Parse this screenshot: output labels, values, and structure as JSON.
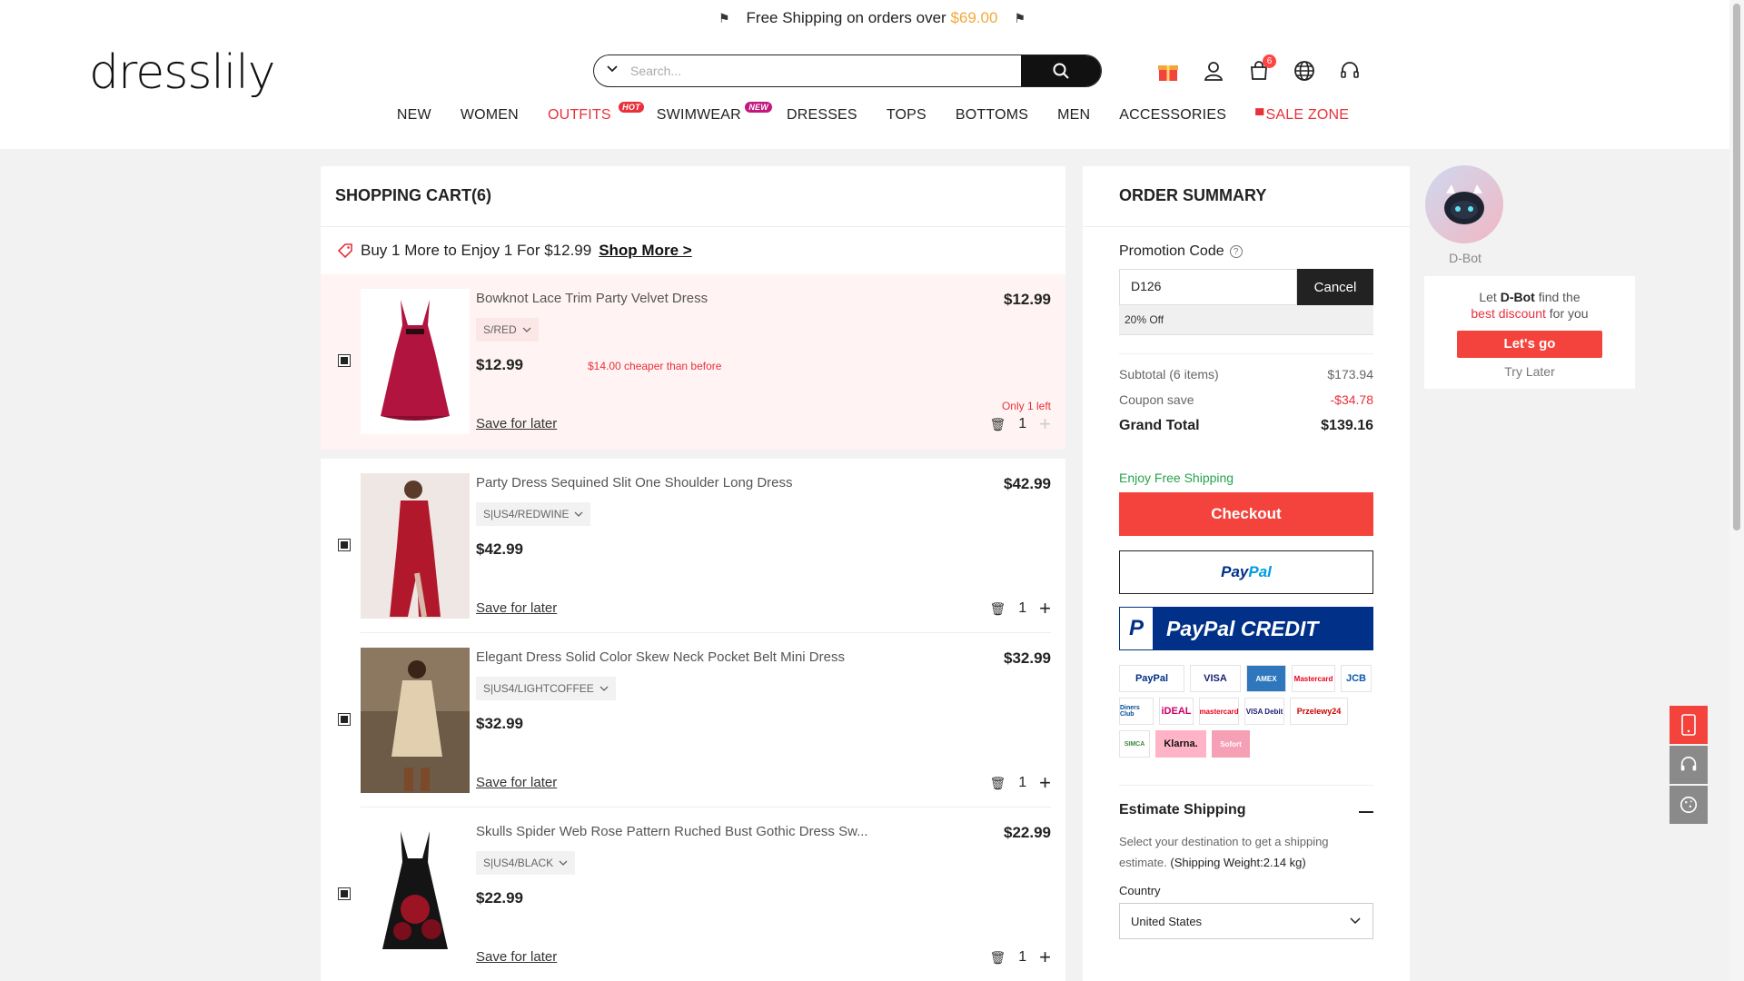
{
  "topbar": {
    "text": "Free Shipping on orders over",
    "amount": "$69.00"
  },
  "header": {
    "logo": "dresslily",
    "search_placeholder": "Search...",
    "cart_count": "6"
  },
  "nav": [
    {
      "label": "NEW"
    },
    {
      "label": "WOMEN"
    },
    {
      "label": "OUTFITS",
      "tag": "HOT"
    },
    {
      "label": "SWIMWEAR",
      "tag": "NEW"
    },
    {
      "label": "DRESSES"
    },
    {
      "label": "TOPS"
    },
    {
      "label": "BOTTOMS"
    },
    {
      "label": "MEN"
    },
    {
      "label": "ACCESSORIES"
    },
    {
      "label": "SALE ZONE"
    }
  ],
  "cart": {
    "title": "SHOPPING CART(6)",
    "promo_text": "Buy 1 More to Enjoy 1 For $12.99",
    "promo_link": "Shop More >",
    "save_for_later": "Save for later",
    "items": [
      {
        "name": "Bowknot Lace Trim Party Velvet Dress",
        "price": "$12.99",
        "variant": "S/RED",
        "current": "$12.99",
        "note": "$14.00 cheaper than before",
        "stock": "Only 1 left",
        "qty": "1"
      },
      {
        "name": "Party Dress Sequined Slit One Shoulder Long Dress",
        "price": "$42.99",
        "variant": "S|US4/REDWINE",
        "current": "$42.99",
        "qty": "1"
      },
      {
        "name": "Elegant Dress Solid Color Skew Neck Pocket Belt Mini Dress",
        "price": "$32.99",
        "variant": "S|US4/LIGHTCOFFEE",
        "current": "$32.99",
        "qty": "1"
      },
      {
        "name": "Skulls Spider Web Rose Pattern Ruched Bust Gothic Dress Sw...",
        "price": "$22.99",
        "variant": "S|US4/BLACK",
        "current": "$22.99",
        "qty": "1"
      }
    ]
  },
  "summary": {
    "title": "ORDER SUMMARY",
    "promo_label": "Promotion Code",
    "promo_code": "D126",
    "cancel": "Cancel",
    "discount": "20% Off",
    "subtotal_label": "Subtotal (6 items)",
    "subtotal": "$173.94",
    "coupon_label": "Coupon save",
    "coupon": "-$34.78",
    "grand_label": "Grand Total",
    "grand": "$139.16",
    "free_shipping": "Enjoy Free Shipping",
    "checkout": "Checkout",
    "paypal_a": "Pay",
    "paypal_b": "Pal",
    "paypal_credit": "PayPal CREDIT",
    "payment_methods": [
      "PayPal",
      "VISA",
      "AMEX",
      "Mastercard",
      "JCB",
      "Diners Club",
      "iDEAL",
      "mastercard",
      "VISA Debit",
      "Przelewy24",
      "SIMCA",
      "Klarna.",
      "Sofort"
    ],
    "estimate_title": "Estimate Shipping",
    "estimate_desc": "Select your destination to get a shipping estimate.",
    "weight": "(Shipping Weight:2.14 kg)",
    "country_label": "Country",
    "country": "United States"
  },
  "dbot": {
    "name": "D-Bot",
    "line_a": "Let",
    "line_b": "D-Bot",
    "line_c": "find the",
    "line_d": "best discount",
    "line_e": "for you",
    "go": "Let's go",
    "later": "Try Later"
  }
}
